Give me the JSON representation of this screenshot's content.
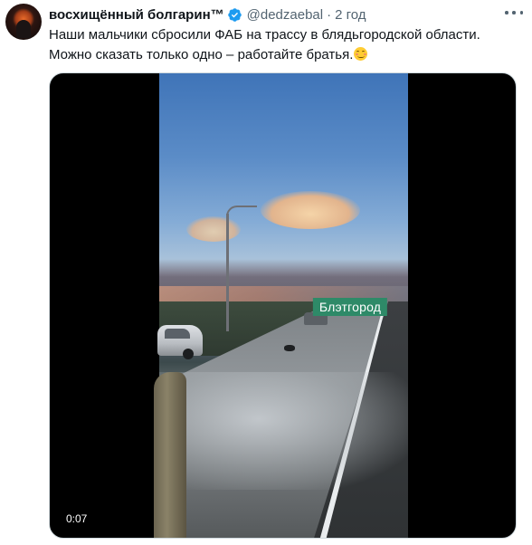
{
  "tweet": {
    "author_name": "восхищённый болгарин™",
    "handle": "@dedzaebal",
    "separator": "·",
    "time": "2 год",
    "text_line1": "Наши мальчики сбросили ФАБ на трассу в блядьгородской области.",
    "text_line2": "Можно сказать только одно – работайте братья.",
    "emoji": "smiling-face-icon"
  },
  "media": {
    "city_sign": "Блэтгород",
    "duration": "0:07"
  },
  "icons": {
    "verified": "verified-badge-icon",
    "more": "more-options-icon"
  },
  "colors": {
    "verified": "#1d9bf0",
    "secondary_text": "#536471",
    "sign": "#2e8a68"
  }
}
